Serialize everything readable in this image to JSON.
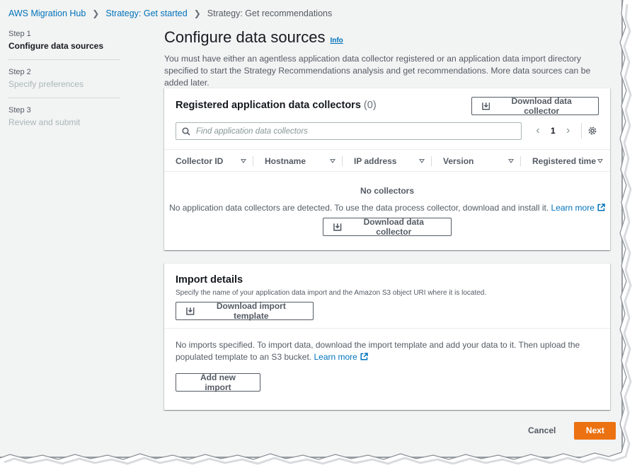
{
  "breadcrumb": {
    "items": [
      "AWS Migration Hub",
      "Strategy: Get started",
      "Strategy: Get recommendations"
    ]
  },
  "steps": [
    {
      "num": "Step 1",
      "title": "Configure data sources"
    },
    {
      "num": "Step 2",
      "title": "Specify preferences"
    },
    {
      "num": "Step 3",
      "title": "Review and submit"
    }
  ],
  "page": {
    "title": "Configure data sources",
    "info": "Info",
    "description": "You must have either an agentless application data collector registered or an application data import directory specified to start the Strategy Recommendations analysis and get recommendations. More data sources can be added later."
  },
  "collectors": {
    "title": "Registered application data collectors",
    "count": "(0)",
    "download_button": "Download data collector",
    "search_placeholder": "Find application data collectors",
    "page_number": "1",
    "columns": [
      "Collector ID",
      "Hostname",
      "IP address",
      "Version",
      "Registered time"
    ],
    "empty_title": "No collectors",
    "empty_desc": "No application data collectors are detected. To use the data process collector, download and install it.",
    "learn_more": "Learn more",
    "empty_button": "Download data collector"
  },
  "imports": {
    "title": "Import details",
    "subtitle": "Specify the name of your application data import and the Amazon S3 object URI where it is located.",
    "template_button": "Download import template",
    "desc": "No imports specified. To import data, download the import template and add your data to it. Then upload the populated template to an S3 bucket.",
    "learn_more": "Learn more",
    "add_button": "Add new import"
  },
  "footer": {
    "cancel": "Cancel",
    "next": "Next"
  },
  "colors": {
    "link": "#0073bb",
    "primary": "#ec7211",
    "background": "#f2f3f3"
  }
}
